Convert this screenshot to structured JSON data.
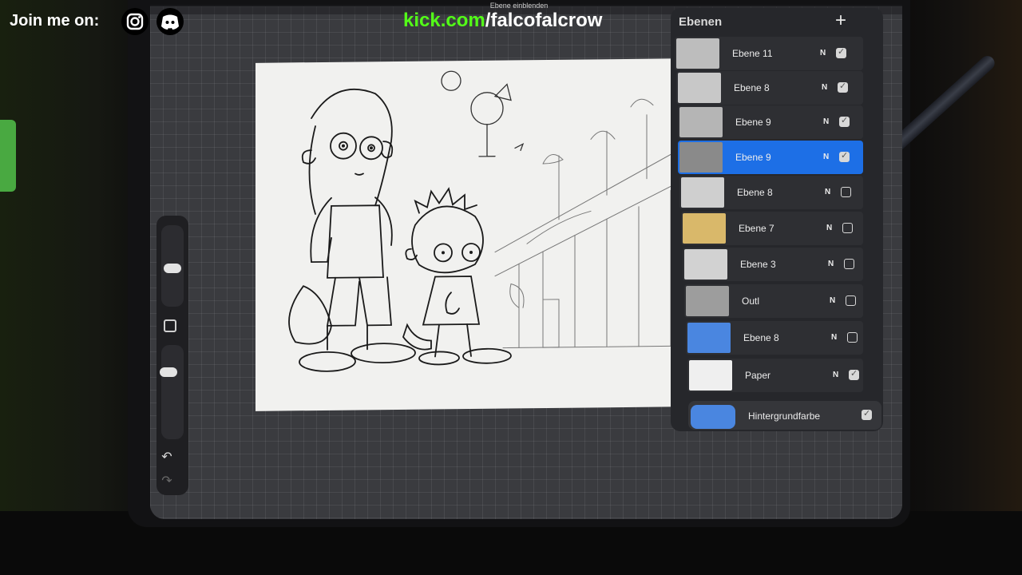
{
  "overlay": {
    "join_text": "Join me on:",
    "instagram_icon": "instagram-icon",
    "discord_icon": "discord-icon",
    "kick_domain": "kick.com",
    "kick_path": "/falcofalcrow",
    "kick_color": "#53fc18"
  },
  "app": {
    "top_hint": "Ebene einblenden"
  },
  "sidebar": {
    "modify_icon": "square-icon",
    "undo_icon": "undo-icon",
    "redo_icon": "redo-icon"
  },
  "layers": {
    "title": "Ebenen",
    "add_icon": "plus-icon",
    "items": [
      {
        "name": "Ebene 11",
        "mode": "N",
        "visible": true,
        "selected": false,
        "thumb": "#bdbdbd"
      },
      {
        "name": "Ebene 8",
        "mode": "N",
        "visible": true,
        "selected": false,
        "thumb": "#c8c8c8"
      },
      {
        "name": "Ebene 9",
        "mode": "N",
        "visible": true,
        "selected": false,
        "thumb": "#b5b5b5"
      },
      {
        "name": "Ebene 9",
        "mode": "N",
        "visible": true,
        "selected": true,
        "thumb": "#8a8a8a"
      },
      {
        "name": "Ebene 8",
        "mode": "N",
        "visible": false,
        "selected": false,
        "thumb": "#cfcfcf"
      },
      {
        "name": "Ebene 7",
        "mode": "N",
        "visible": false,
        "selected": false,
        "thumb": "#d9b86a"
      },
      {
        "name": "Ebene 3",
        "mode": "N",
        "visible": false,
        "selected": false,
        "thumb": "#d2d2d2"
      },
      {
        "name": "Outl",
        "mode": "N",
        "visible": false,
        "selected": false,
        "thumb": "#9d9d9d"
      },
      {
        "name": "Ebene 8",
        "mode": "N",
        "visible": false,
        "selected": false,
        "thumb": "#4a86e0"
      },
      {
        "name": "Paper",
        "mode": "N",
        "visible": true,
        "selected": false,
        "thumb": "#efefef"
      }
    ],
    "background": {
      "label": "Hintergrundfarbe",
      "color": "#4a86e0",
      "visible": true
    }
  }
}
